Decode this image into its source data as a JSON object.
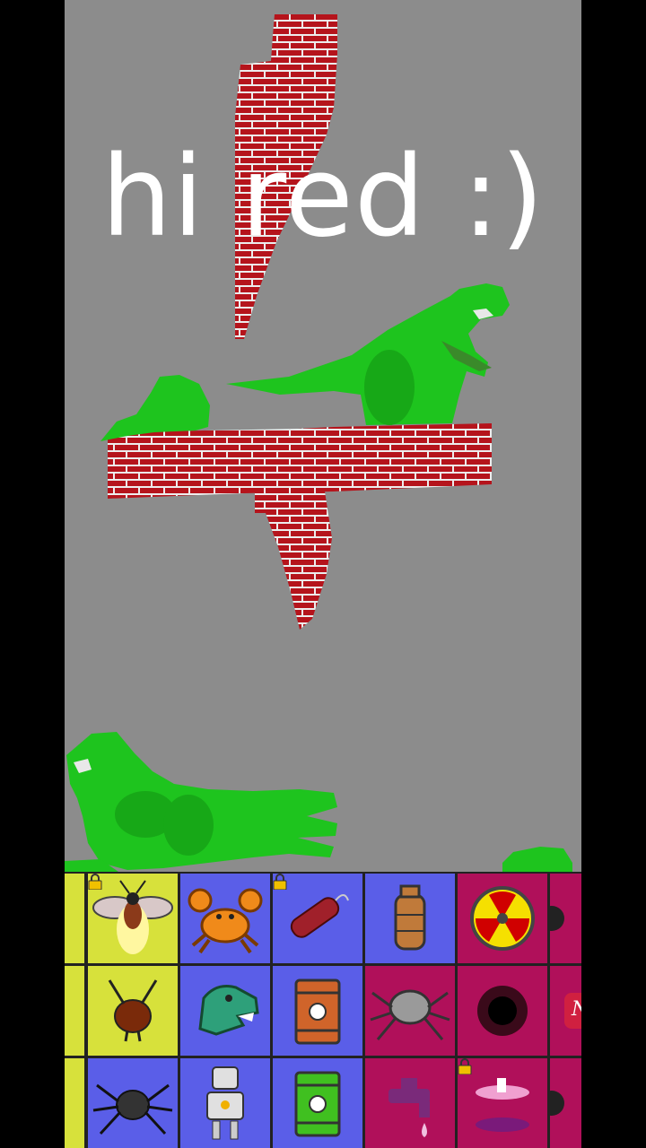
{
  "scene": {
    "caption": "hi red :)",
    "background_color": "#8c8c8c",
    "entities": [
      "brick-wall",
      "brick-wall",
      "brick-wall",
      "dinosaur",
      "dinosaur",
      "dinosaur",
      "acid-splash",
      "acid-splash"
    ]
  },
  "palette": {
    "colors": {
      "yellow": "#d7e13b",
      "blue": "#5a5ee8",
      "magenta": "#b0105a"
    },
    "rows": [
      [
        {
          "icon": "partial-icon",
          "bg": "yellow",
          "locked": true
        },
        {
          "icon": "firefly-icon",
          "bg": "yellow",
          "locked": true
        },
        {
          "icon": "crab-icon",
          "bg": "blue",
          "locked": false
        },
        {
          "icon": "dynamite-icon",
          "bg": "blue",
          "locked": true
        },
        {
          "icon": "gas-cylinder-icon",
          "bg": "blue",
          "locked": false
        },
        {
          "icon": "radiation-icon",
          "bg": "magenta",
          "locked": false
        },
        {
          "icon": "partial-icon",
          "bg": "magenta",
          "locked": false
        }
      ],
      [
        {
          "icon": "partial-icon",
          "bg": "yellow",
          "locked": false
        },
        {
          "icon": "ant-icon",
          "bg": "yellow",
          "locked": false
        },
        {
          "icon": "trex-head-icon",
          "bg": "blue",
          "locked": false
        },
        {
          "icon": "oil-barrel-icon",
          "bg": "blue",
          "locked": false
        },
        {
          "icon": "robot-spider-icon",
          "bg": "magenta",
          "locked": false
        },
        {
          "icon": "black-hole-icon",
          "bg": "magenta",
          "locked": false
        },
        {
          "icon": "neon-sign-icon",
          "bg": "magenta",
          "locked": false,
          "label": "Ne"
        }
      ],
      [
        {
          "icon": "partial-icon",
          "bg": "yellow",
          "locked": true
        },
        {
          "icon": "spider-icon",
          "bg": "blue",
          "locked": false
        },
        {
          "icon": "robot-icon",
          "bg": "blue",
          "locked": false
        },
        {
          "icon": "acid-barrel-icon",
          "bg": "blue",
          "locked": false
        },
        {
          "icon": "water-tap-icon",
          "bg": "magenta",
          "locked": false
        },
        {
          "icon": "portal-icon",
          "bg": "magenta",
          "locked": true
        },
        {
          "icon": "partial-icon",
          "bg": "magenta",
          "locked": false
        }
      ]
    ]
  }
}
